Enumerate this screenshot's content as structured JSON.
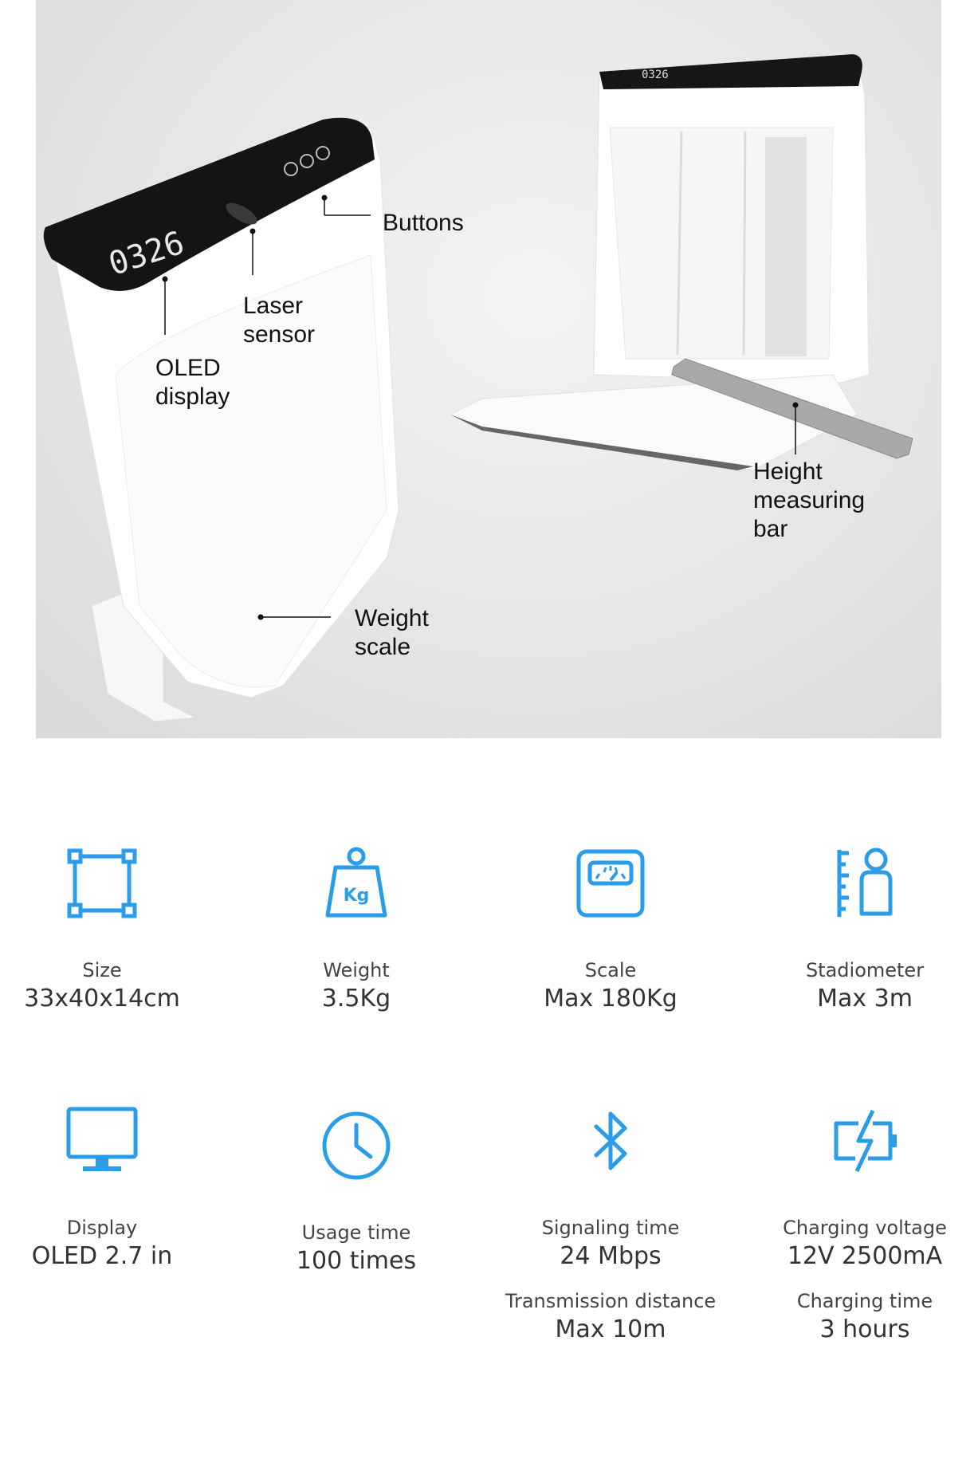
{
  "hero": {
    "display_digits": "0326",
    "callouts": {
      "buttons": "Buttons",
      "laser_sensor": "Laser\nsensor",
      "oled_display": "OLED\ndisplay",
      "height_bar": "Height\nmeasuring\nbar",
      "weight_scale": "Weight\nscale"
    }
  },
  "accent_color": "#2b9de8",
  "specs": [
    {
      "icon": "size-icon",
      "label": "Size",
      "value": "33x40x14cm"
    },
    {
      "icon": "weight-kg-icon",
      "label": "Weight",
      "value": "3.5Kg",
      "icon_text": "Kg"
    },
    {
      "icon": "scale-icon",
      "label": "Scale",
      "value": "Max 180Kg"
    },
    {
      "icon": "stadiometer-icon",
      "label": "Stadiometer",
      "value": "Max 3m"
    },
    {
      "icon": "monitor-icon",
      "label": "Display",
      "value": "OLED 2.7 in"
    },
    {
      "icon": "clock-icon",
      "label": "Usage time",
      "value": "100 times"
    },
    {
      "icon": "bluetooth-icon",
      "label": "Signaling time",
      "value": "24 Mbps",
      "label2": "Transmission distance",
      "value2": "Max 10m"
    },
    {
      "icon": "battery-charging-icon",
      "label": "Charging voltage",
      "value": "12V 2500mA",
      "label2": "Charging time",
      "value2": "3 hours"
    }
  ]
}
